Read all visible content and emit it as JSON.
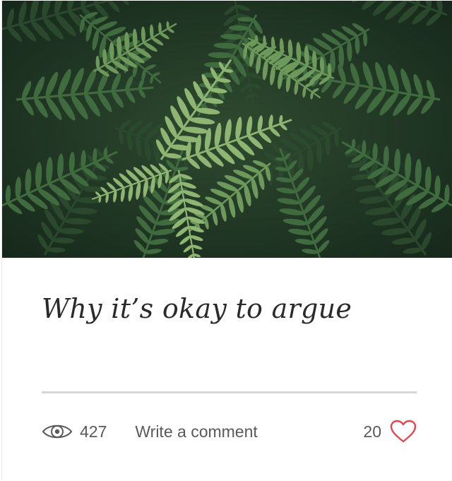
{
  "post": {
    "title": "Why it’s okay to argue"
  },
  "hero_image": {
    "subject": "fern-leaves"
  },
  "stats": {
    "views": "427",
    "comment_label": "Write a comment",
    "likes": "20"
  },
  "icons": {
    "views": "eye-icon",
    "likes": "heart-icon"
  },
  "colors": {
    "heart": "#e0474c",
    "text": "#595959",
    "title": "#2a2a2a",
    "divider": "#d6d6d6"
  }
}
